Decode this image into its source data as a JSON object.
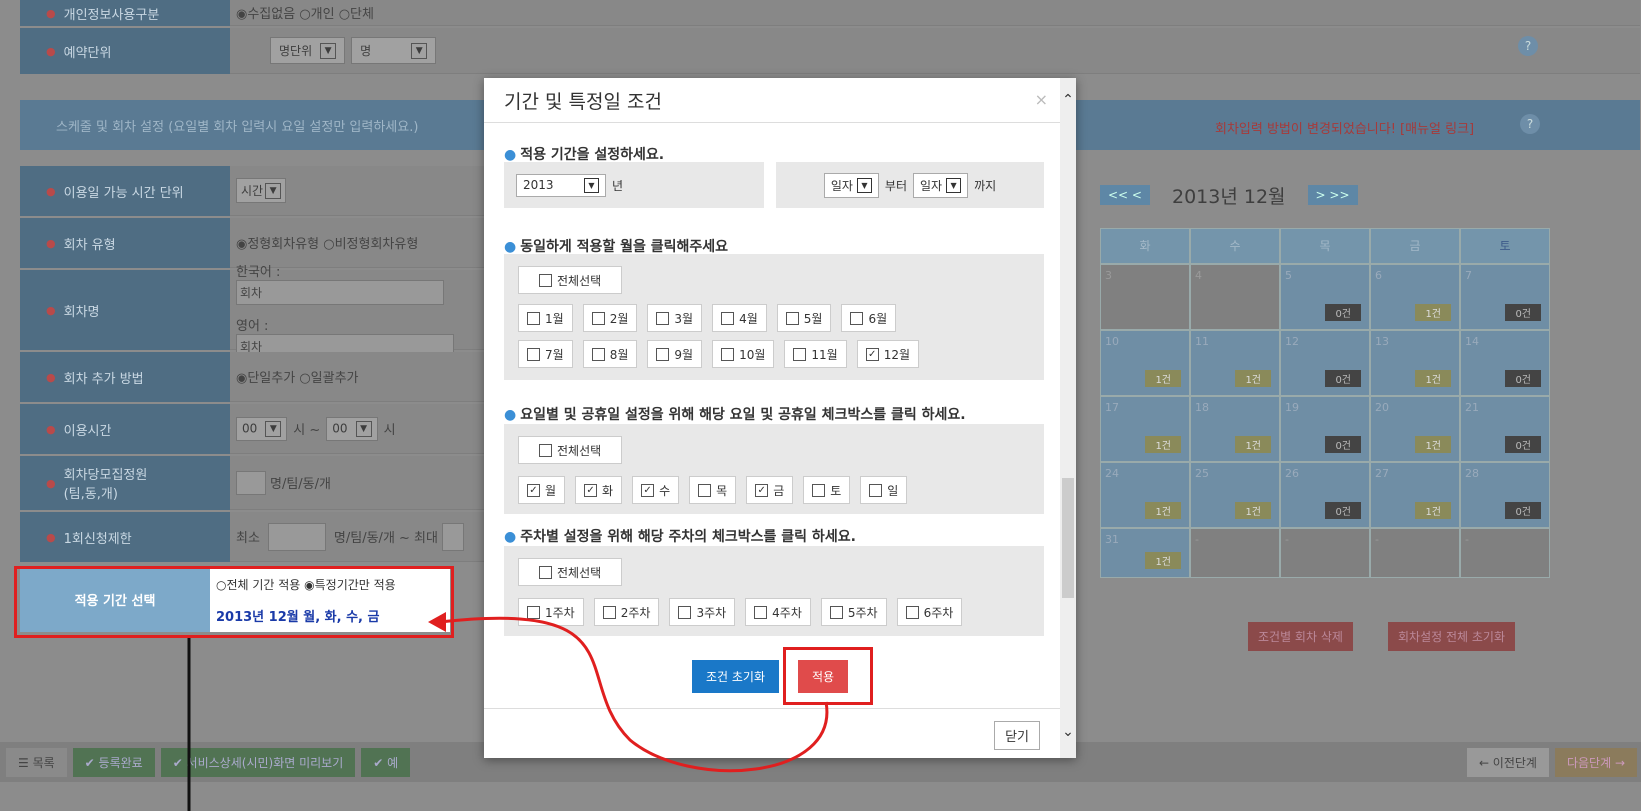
{
  "form": {
    "row0_label": "개인정보사용구분",
    "row0_value": "◉수집없음 ○개인 ○단체",
    "unit_label": "예약단위",
    "unit_sel1": "명단위",
    "unit_sel2": "명",
    "schedule_title": "스케줄 및 회차 설정 (요일별 회차 입력시 요일 설정만 입력하세요.)",
    "notice": "회차입력 방법이 변경되었습니다! [매뉴얼 링크]",
    "time_unit_label": "이용일 가능 시간 단위",
    "time_unit_value": "시간",
    "session_type_label": "회차 유형",
    "session_type_value": "◉정형회차유형 ○비정형회차유형",
    "session_name_label": "회차명",
    "korean": "한국어 :",
    "korean_ph": "회차",
    "english": "영어 :",
    "english_ph": "회차",
    "add_method_label": "회차 추가 방법",
    "add_method_value": "◉단일추가 ○일괄추가",
    "use_time_label": "이용시간",
    "use_time_from": "00",
    "use_time_sep": "시 ~",
    "use_time_to": "00",
    "use_time_end": "시",
    "capacity_label": "회차당모집정원\n(팀,동,개)",
    "capacity_unit": "명/팀/동/개",
    "limit_label": "1회신청제한",
    "limit_min": "최소",
    "limit_mid": "명/팀/동/개 ~ 최대"
  },
  "period_select": {
    "label": "적용 기간 선택",
    "options": "○전체 기간 적용 ◉특정기간만 적용",
    "summary": "2013년 12월 월, 화, 수, 금"
  },
  "calendar": {
    "title": "2013년 12월",
    "nav_prev": "<< <",
    "nav_next": "> >>",
    "headers": [
      "화",
      "수",
      "목",
      "금",
      "토"
    ],
    "rows": [
      [
        {
          "d": "3",
          "b": ""
        },
        {
          "d": "4",
          "b": ""
        },
        {
          "d": "5",
          "b": "0건"
        },
        {
          "d": "6",
          "b": "1건"
        },
        {
          "d": "7",
          "b": "0건"
        }
      ],
      [
        {
          "d": "10",
          "b": "1건"
        },
        {
          "d": "11",
          "b": "1건"
        },
        {
          "d": "12",
          "b": "0건"
        },
        {
          "d": "13",
          "b": "1건"
        },
        {
          "d": "14",
          "b": "0건"
        }
      ],
      [
        {
          "d": "17",
          "b": "1건"
        },
        {
          "d": "18",
          "b": "1건"
        },
        {
          "d": "19",
          "b": "0건"
        },
        {
          "d": "20",
          "b": "1건"
        },
        {
          "d": "21",
          "b": "0건"
        }
      ],
      [
        {
          "d": "24",
          "b": "1건"
        },
        {
          "d": "25",
          "b": "1건"
        },
        {
          "d": "26",
          "b": "0건"
        },
        {
          "d": "27",
          "b": "1건"
        },
        {
          "d": "28",
          "b": "0건"
        }
      ],
      [
        {
          "d": "31",
          "b": "1건"
        },
        {
          "d": "-",
          "b": ""
        },
        {
          "d": "-",
          "b": ""
        },
        {
          "d": "-",
          "b": ""
        },
        {
          "d": "-",
          "b": ""
        }
      ]
    ],
    "delete_btn": "조건별 회차 삭제",
    "reset_btn": "회차설정 전체 초기화"
  },
  "bottom": {
    "list": "☰ 목록",
    "done": "✔ 등록완료",
    "preview": "✔ 서비스상세(시민)화면 미리보기",
    "preview2": "✔ 예",
    "prev": "← 이전단계",
    "next": "다음단계 →"
  },
  "modal": {
    "title": "기간 및 특정일 조건",
    "close_x": "×",
    "sec1": "적용 기간을 설정하세요.",
    "year": "2013",
    "year_unit": "년",
    "from_sel": "일자",
    "from_txt": "부터",
    "to_sel": "일자",
    "to_txt": "까지",
    "sec2": "동일하게 적용할 월을 클릭해주세요",
    "select_all": "전체선택",
    "months": [
      {
        "l": "1월",
        "c": false
      },
      {
        "l": "2월",
        "c": false
      },
      {
        "l": "3월",
        "c": false
      },
      {
        "l": "4월",
        "c": false
      },
      {
        "l": "5월",
        "c": false
      },
      {
        "l": "6월",
        "c": false
      },
      {
        "l": "7월",
        "c": false
      },
      {
        "l": "8월",
        "c": false
      },
      {
        "l": "9월",
        "c": false
      },
      {
        "l": "10월",
        "c": false
      },
      {
        "l": "11월",
        "c": false
      },
      {
        "l": "12월",
        "c": true
      }
    ],
    "sec3": "요일별 및 공휴일 설정을 위해 해당 요일 및 공휴일 체크박스를 클릭 하세요.",
    "days": [
      {
        "l": "월",
        "c": true
      },
      {
        "l": "화",
        "c": true
      },
      {
        "l": "수",
        "c": true
      },
      {
        "l": "목",
        "c": false
      },
      {
        "l": "금",
        "c": true
      },
      {
        "l": "토",
        "c": false
      },
      {
        "l": "일",
        "c": false
      }
    ],
    "sec4": "주차별 설정을 위해 해당 주차의 체크박스를 클릭 하세요.",
    "weeks": [
      {
        "l": "1주차",
        "c": false
      },
      {
        "l": "2주차",
        "c": false
      },
      {
        "l": "3주차",
        "c": false
      },
      {
        "l": "4주차",
        "c": false
      },
      {
        "l": "5주차",
        "c": false
      },
      {
        "l": "6주차",
        "c": false
      }
    ],
    "reset": "조건 초기화",
    "apply": "적용",
    "close": "닫기"
  }
}
